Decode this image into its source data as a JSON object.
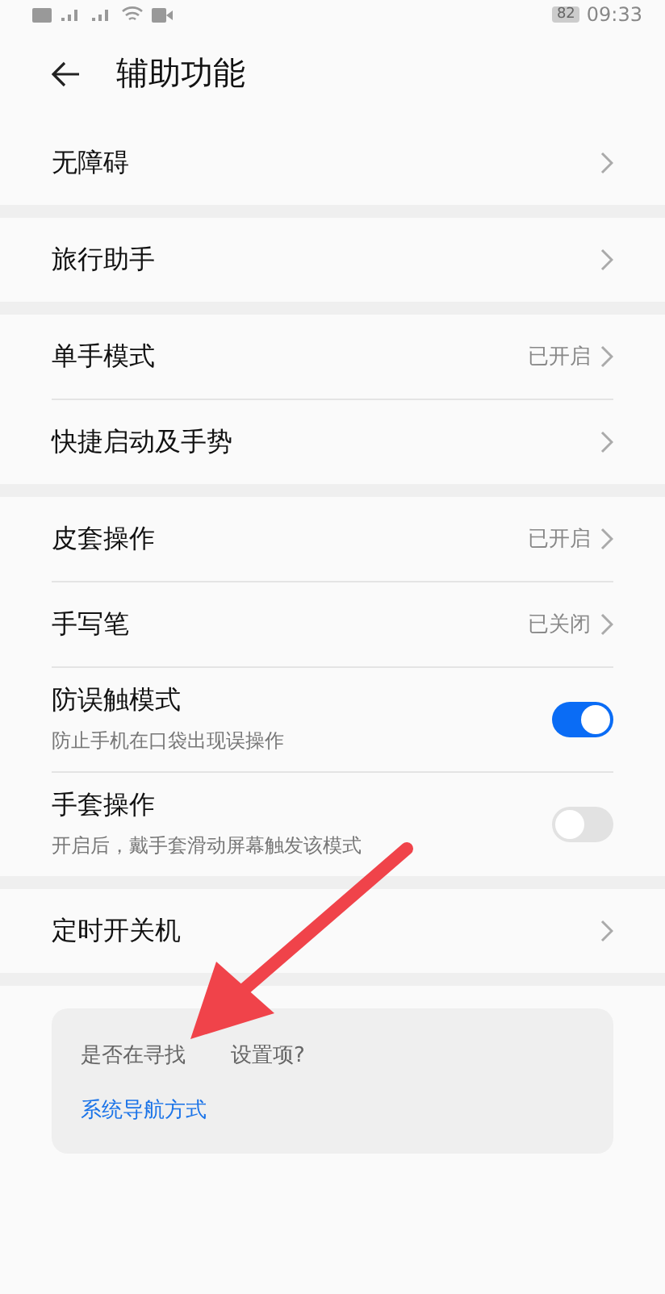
{
  "status_bar": {
    "battery": "82",
    "time": "09:33"
  },
  "header": {
    "title": "辅助功能"
  },
  "groups": [
    [
      {
        "kind": "link",
        "label": "无障碍"
      }
    ],
    [
      {
        "kind": "link",
        "label": "旅行助手"
      }
    ],
    [
      {
        "kind": "link",
        "label": "单手模式",
        "value": "已开启"
      },
      {
        "kind": "link",
        "label": "快捷启动及手势"
      }
    ],
    [
      {
        "kind": "link",
        "label": "皮套操作",
        "value": "已开启"
      },
      {
        "kind": "link",
        "label": "手写笔",
        "value": "已关闭"
      },
      {
        "kind": "toggle",
        "label": "防误触模式",
        "description": "防止手机在口袋出现误操作",
        "on": true
      },
      {
        "kind": "toggle",
        "label": "手套操作",
        "description": "开启后，戴手套滑动屏幕触发该模式",
        "on": false
      }
    ],
    [
      {
        "kind": "link",
        "label": "定时开关机"
      }
    ]
  ],
  "suggestion": {
    "question_start": "是否在寻找",
    "question_end": "设置项?",
    "link": "系统导航方式"
  }
}
